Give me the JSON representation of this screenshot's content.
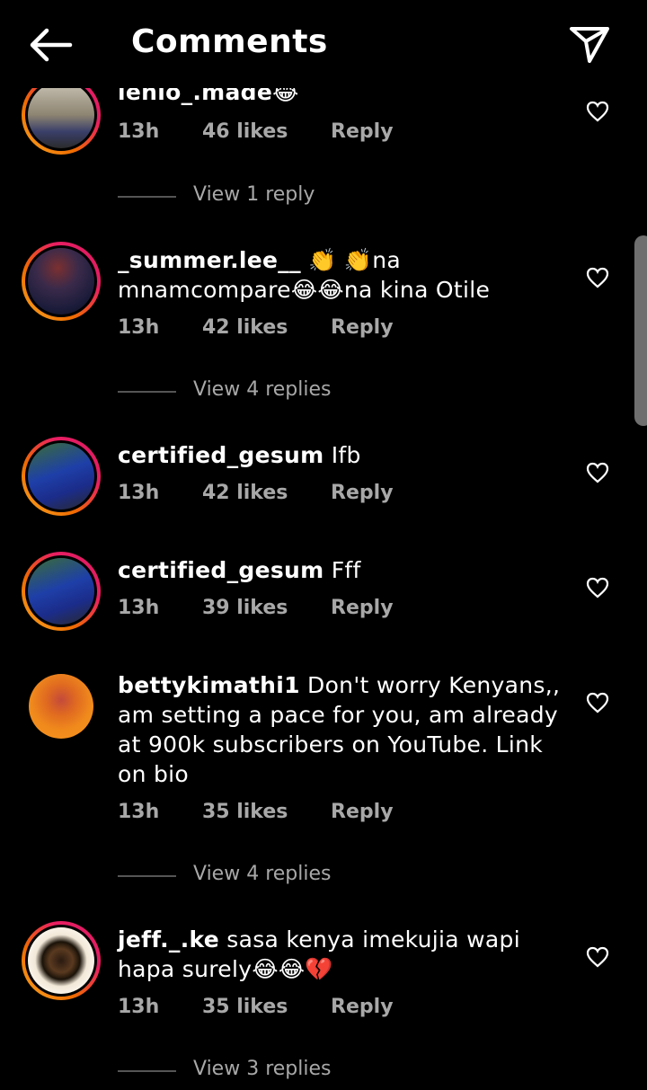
{
  "header": {
    "title": "Comments",
    "back_icon": "arrow-left-icon",
    "send_icon": "paper-plane-icon"
  },
  "comments": [
    {
      "user": "lenio_.made",
      "text": "😂",
      "time": "13h",
      "likes": "46 likes",
      "reply": "Reply",
      "view": "View 1 reply"
    },
    {
      "user": "_summer.lee__",
      "text": " 👏 👏na mnamcompare😂😂na kina Otile",
      "time": "13h",
      "likes": "42 likes",
      "reply": "Reply",
      "view": "View 4 replies"
    },
    {
      "user": "certified_gesum",
      "text": " Ifb",
      "time": "13h",
      "likes": "42 likes",
      "reply": "Reply"
    },
    {
      "user": "certified_gesum",
      "text": " Fff",
      "time": "13h",
      "likes": "39 likes",
      "reply": "Reply"
    },
    {
      "user": "bettykimathi1",
      "text": " Don't worry Kenyans,, am setting a pace for you, am already at 900k subscribers on YouTube. Link on bio",
      "time": "13h",
      "likes": "35 likes",
      "reply": "Reply",
      "view": "View 4 replies"
    },
    {
      "user": "jeff._.ke",
      "text": " sasa kenya imekujia wapi hapa surely😂😂💔",
      "time": "13h",
      "likes": "35 likes",
      "reply": "Reply",
      "view": "View 3 replies"
    }
  ]
}
